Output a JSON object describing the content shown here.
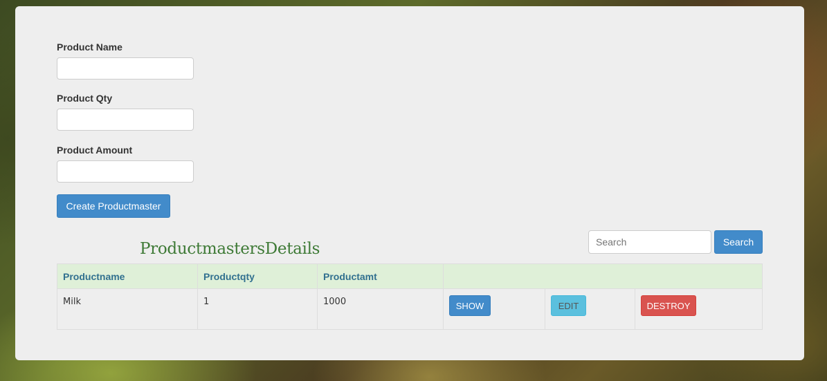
{
  "form": {
    "name_label": "Product Name",
    "qty_label": "Product Qty",
    "amount_label": "Product Amount",
    "name_value": "",
    "qty_value": "",
    "amount_value": "",
    "create_button": "Create Productmaster"
  },
  "search": {
    "placeholder": "Search",
    "button": "Search"
  },
  "table": {
    "title": "ProductmastersDetails",
    "columns": [
      "Productname",
      "Productqty",
      "Productamt",
      ""
    ],
    "rows": [
      {
        "name": "Milk",
        "qty": "1",
        "amt": "1000",
        "show": "SHOW",
        "edit": "EDIT",
        "destroy": "DESTROY"
      }
    ]
  },
  "colors": {
    "primary": "#428bca",
    "info": "#5bc0de",
    "danger": "#d9534f",
    "header_bg": "#dff0d8",
    "title": "#3e7a36"
  }
}
